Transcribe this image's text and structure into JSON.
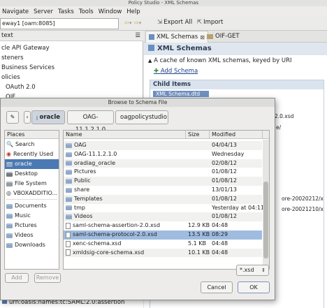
{
  "window": {
    "title": "Policy Studio - XML Schemas"
  },
  "menu": [
    "Navigate",
    "Server",
    "Tasks",
    "Tools",
    "Window",
    "Help"
  ],
  "toolbar": {
    "server_text": "eway1 [oam:8085]",
    "export_all": "Export All",
    "import": "Import"
  },
  "left_tree": {
    "header": "text",
    "items": [
      "cle API Gateway",
      "steners",
      "Business Services",
      "olicies",
      "OAuth 2.0",
      "OIF"
    ],
    "status_line": "urn:oasis:names:tc:SAML:2.0:assertion"
  },
  "right": {
    "tabs": [
      {
        "label": "XML Schemas"
      },
      {
        "label": "OIF-GET"
      }
    ],
    "header": "XML Schemas",
    "description": "A cache of known XML schemas, keyed by URI",
    "add_schema": "Add Schema",
    "child_items_title": "Child Items",
    "child_fragments": [
      "XML Schema.dtd",
      "2.0.xsd",
      "e/",
      "ore-20020212/x",
      "ore-20021210/x"
    ]
  },
  "dialog": {
    "title": "Browse to Schema File",
    "breadcrumbs": [
      "oracle",
      "OAG-11.1.2.1.0",
      "oagpolicystudio"
    ],
    "places_header": "Places",
    "places": [
      "Search",
      "Recently Used",
      "oracle",
      "Desktop",
      "File System",
      "VBOXADDITIO...",
      "Documents",
      "Music",
      "Pictures",
      "Videos",
      "Downloads"
    ],
    "selected_place": "oracle",
    "columns": {
      "name": "Name",
      "size": "Size",
      "modified": "Modified"
    },
    "files": [
      {
        "name": "OAG",
        "size": "",
        "modified": "04/04/13",
        "type": "folder"
      },
      {
        "name": "OAG-11.1.2.1.0",
        "size": "",
        "modified": "Wednesday",
        "type": "folder"
      },
      {
        "name": "oradiag_oracle",
        "size": "",
        "modified": "02/08/12",
        "type": "folder"
      },
      {
        "name": "Pictures",
        "size": "",
        "modified": "01/08/12",
        "type": "folder"
      },
      {
        "name": "Public",
        "size": "",
        "modified": "01/08/12",
        "type": "folder"
      },
      {
        "name": "share",
        "size": "",
        "modified": "13/01/13",
        "type": "folder"
      },
      {
        "name": "Templates",
        "size": "",
        "modified": "01/08/12",
        "type": "folder"
      },
      {
        "name": "tmp",
        "size": "",
        "modified": "Yesterday at 04:11",
        "type": "folder"
      },
      {
        "name": "Videos",
        "size": "",
        "modified": "01/08/12",
        "type": "folder"
      },
      {
        "name": "saml-schema-assertion-2.0.xsd",
        "size": "12.9 KB",
        "modified": "04:48",
        "type": "file"
      },
      {
        "name": "saml-schema-protocol-2.0.xsd",
        "size": "13.5 KB",
        "modified": "08:29",
        "type": "file",
        "selected": true
      },
      {
        "name": "xenc-schema.xsd",
        "size": "5.1 KB",
        "modified": "04:48",
        "type": "file"
      },
      {
        "name": "xmldsig-core-schema.xsd",
        "size": "10.1 KB",
        "modified": "04:48",
        "type": "file"
      }
    ],
    "add_label": "Add",
    "remove_label": "Remove",
    "filter": "*.xsd",
    "cancel_label": "Cancel",
    "ok_label": "OK"
  }
}
